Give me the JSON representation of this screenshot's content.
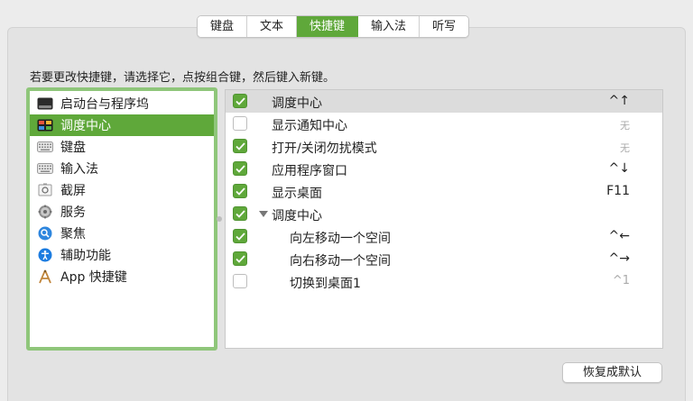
{
  "tabs": [
    {
      "label": "键盘",
      "active": false
    },
    {
      "label": "文本",
      "active": false
    },
    {
      "label": "快捷键",
      "active": true
    },
    {
      "label": "输入法",
      "active": false
    },
    {
      "label": "听写",
      "active": false
    }
  ],
  "instruction": "若要更改快捷键，请选择它，点按组合键，然后键入新键。",
  "categories": [
    {
      "label": "启动台与程序坞",
      "icon": "launchpad-dock-icon",
      "selected": false
    },
    {
      "label": "调度中心",
      "icon": "mission-control-icon",
      "selected": true
    },
    {
      "label": "键盘",
      "icon": "keyboard-icon",
      "selected": false
    },
    {
      "label": "输入法",
      "icon": "input-method-icon",
      "selected": false
    },
    {
      "label": "截屏",
      "icon": "screenshot-icon",
      "selected": false
    },
    {
      "label": "服务",
      "icon": "gear-icon",
      "selected": false
    },
    {
      "label": "聚焦",
      "icon": "spotlight-icon",
      "selected": false
    },
    {
      "label": "辅助功能",
      "icon": "accessibility-icon",
      "selected": false
    },
    {
      "label": "App 快捷键",
      "icon": "app-shortcuts-icon",
      "selected": false
    }
  ],
  "shortcuts": [
    {
      "label": "调度中心",
      "shortcut": "^↑",
      "checked": true,
      "selected": true
    },
    {
      "label": "显示通知中心",
      "shortcut": "无",
      "checked": false
    },
    {
      "label": "打开/关闭勿扰模式",
      "shortcut": "无",
      "checked": true
    },
    {
      "label": "应用程序窗口",
      "shortcut": "^↓",
      "checked": true
    },
    {
      "label": "显示桌面",
      "shortcut": "F11",
      "checked": true
    },
    {
      "label": "调度中心",
      "shortcut": "",
      "checked": true,
      "group": true
    },
    {
      "label": "向左移动一个空间",
      "shortcut": "^←",
      "checked": true,
      "indent": true
    },
    {
      "label": "向右移动一个空间",
      "shortcut": "^→",
      "checked": true,
      "indent": true
    },
    {
      "label": "切换到桌面1",
      "shortcut": "^1",
      "checked": false,
      "indent": true
    }
  ],
  "restore_button": "恢复成默认",
  "colors": {
    "accent": "#5fa83a",
    "list_border": "#8fc67a"
  }
}
